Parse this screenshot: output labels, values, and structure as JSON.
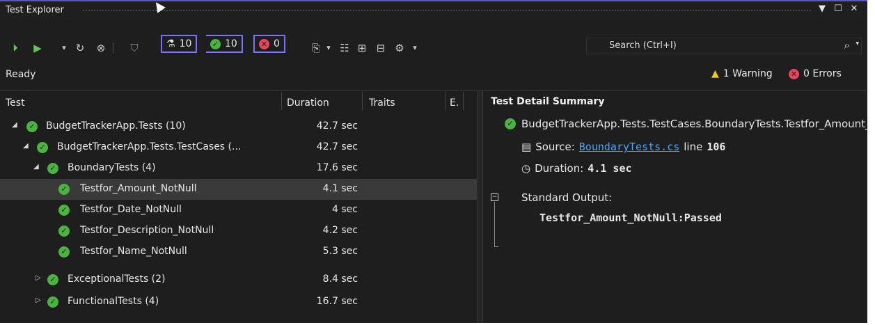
{
  "window": {
    "title": "Test Explorer",
    "controls": {
      "dropdown": "▼",
      "maximize": "☐",
      "close": "✕"
    }
  },
  "toolbar": {
    "run_all_icon": "run-all-icon",
    "run_icon": "run-icon",
    "dropdown_glyph": "▾",
    "counters": {
      "total": "10",
      "passed": "10",
      "failed": "0"
    },
    "search_placeholder": "Search (Ctrl+I)"
  },
  "status": {
    "text": "Ready",
    "warnings": "1 Warning",
    "errors": "0 Errors"
  },
  "columns": {
    "test": "Test",
    "duration": "Duration",
    "traits": "Traits",
    "error": "E."
  },
  "tree": [
    {
      "name": "BudgetTrackerApp.Tests (10)",
      "duration": "42.7 sec"
    },
    {
      "name": "BudgetTrackerApp.Tests.TestCases (...",
      "duration": "42.7 sec"
    },
    {
      "name": "BoundaryTests (4)",
      "duration": "17.6 sec"
    },
    {
      "name": "Testfor_Amount_NotNull",
      "duration": "4.1 sec"
    },
    {
      "name": "Testfor_Date_NotNull",
      "duration": "4 sec"
    },
    {
      "name": "Testfor_Description_NotNull",
      "duration": "4.2 sec"
    },
    {
      "name": "Testfor_Name_NotNull",
      "duration": "5.3 sec"
    },
    {
      "name": "ExceptionalTests (2)",
      "duration": "8.4 sec"
    },
    {
      "name": "FunctionalTests (4)",
      "duration": "16.7 sec"
    }
  ],
  "detail": {
    "title": "Test Detail Summary",
    "full_name": "BudgetTrackerApp.Tests.TestCases.BoundaryTests.Testfor_Amount_NotNull",
    "source_label": "Source:",
    "source_file": "BoundaryTests.cs",
    "line_label": "line",
    "line_number": "106",
    "duration_label": "Duration:",
    "duration_value": "4.1 sec",
    "output_label": "Standard Output:",
    "output_value": "Testfor_Amount_NotNull:Passed"
  }
}
